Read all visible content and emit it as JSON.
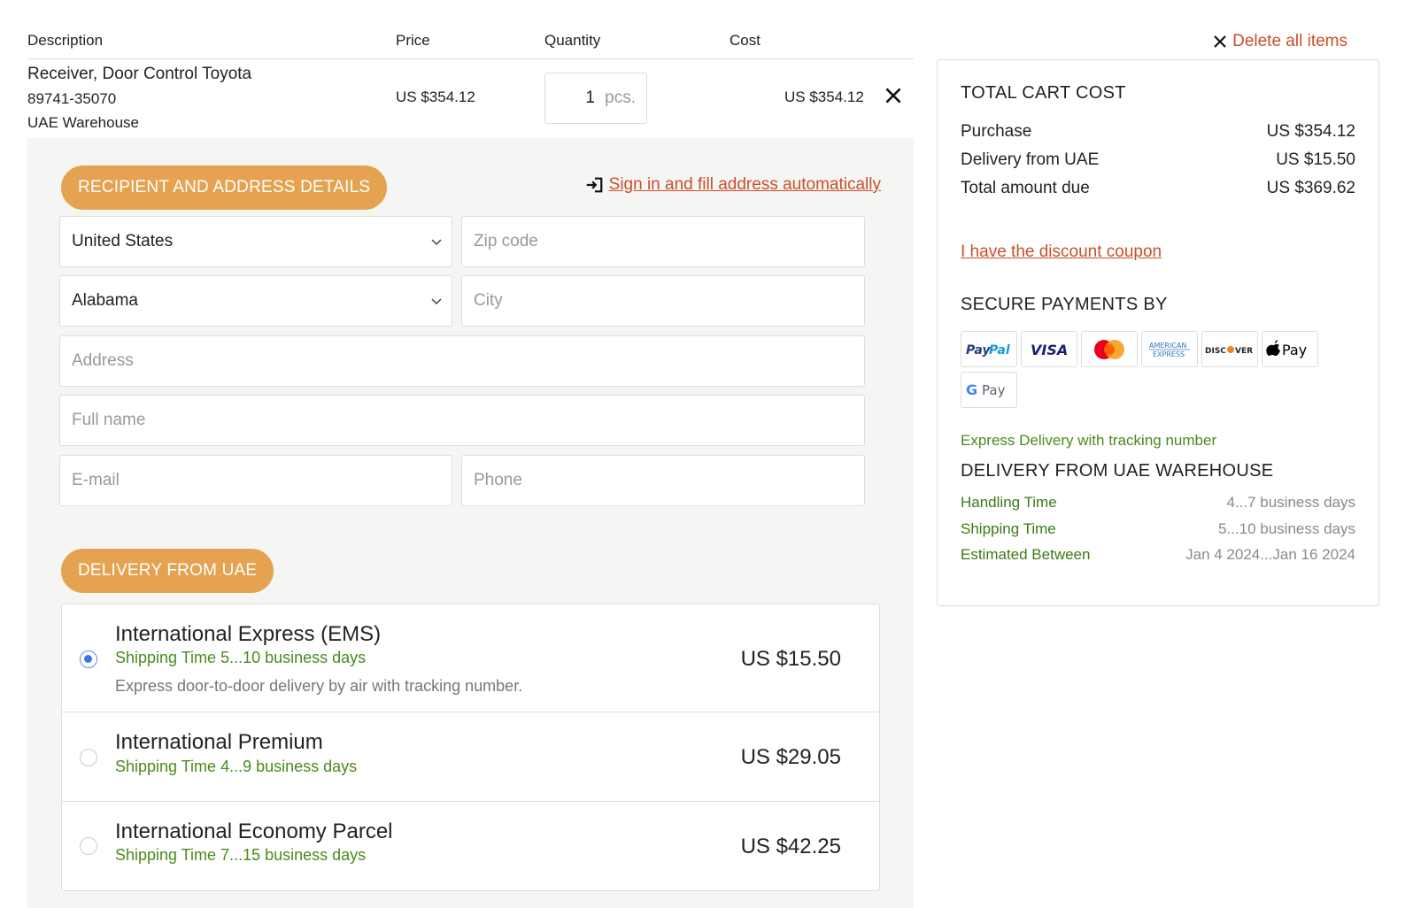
{
  "cart": {
    "headers": {
      "description": "Description",
      "price": "Price",
      "quantity": "Quantity",
      "cost": "Cost"
    },
    "item": {
      "name": "Receiver, Door Control Toyota",
      "part_number": "89741-35070",
      "warehouse": "UAE Warehouse",
      "price": "US $354.12",
      "quantity": "1",
      "quantity_unit": "pcs.",
      "cost": "US $354.12",
      "remove_icon": "close-icon"
    },
    "delete_all_label": "Delete all items"
  },
  "recipient": {
    "section_title": "RECIPIENT AND ADDRESS DETAILS",
    "signin_link": "Sign in and fill address automatically",
    "country": "United States",
    "zip_placeholder": "Zip code",
    "state": "Alabama",
    "city_placeholder": "City",
    "address_placeholder": "Address",
    "fullname_placeholder": "Full name",
    "email_placeholder": "E-mail",
    "phone_placeholder": "Phone"
  },
  "delivery": {
    "section_title": "DELIVERY FROM UAE",
    "options": [
      {
        "name": "International Express (EMS)",
        "shipping": "Shipping Time 5...10 business days",
        "description": "Express door-to-door delivery by air with tracking number.",
        "price": "US $15.50",
        "selected": true
      },
      {
        "name": "International Premium",
        "shipping": "Shipping Time 4...9 business days",
        "price": "US $29.05",
        "selected": false
      },
      {
        "name": "International Economy Parcel",
        "shipping": "Shipping Time 7...15 business days",
        "price": "US $42.25",
        "selected": false
      }
    ]
  },
  "summary": {
    "title": "TOTAL CART COST",
    "purchase_label": "Purchase",
    "purchase_value": "US $354.12",
    "delivery_label": "Delivery from UAE",
    "delivery_value": "US $15.50",
    "total_label": "Total amount due",
    "total_value": "US $369.62",
    "coupon_link": "I have the discount coupon",
    "payments_title": "SECURE PAYMENTS BY",
    "payment_methods": [
      "PayPal",
      "VISA",
      "MasterCard",
      "American Express",
      "DISCOVER",
      "Apple Pay",
      "G Pay"
    ],
    "express_note": "Express Delivery with tracking number",
    "warehouse_title": "DELIVERY FROM UAE WAREHOUSE",
    "handling_label": "Handling Time",
    "handling_value": "4...7 business days",
    "shipping_label": "Shipping Time",
    "shipping_value": "5...10 business days",
    "estimated_label": "Estimated Between",
    "estimated_value": "Jan 4 2024...Jan 16 2024"
  },
  "colors": {
    "accent": "#e5a352",
    "link": "#c8502a",
    "green": "#4a8a1e",
    "radio": "#3a78e0"
  }
}
